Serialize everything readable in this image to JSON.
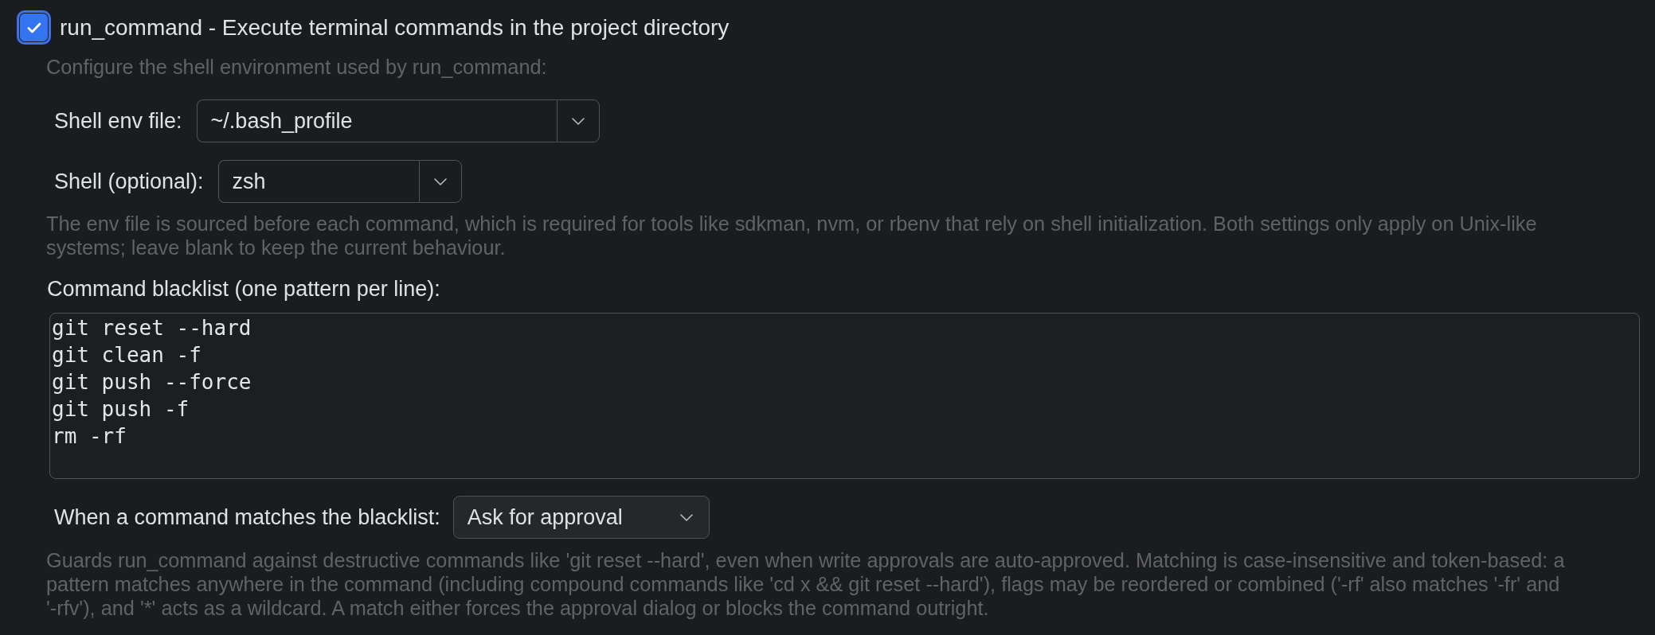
{
  "tool": {
    "label": "run_command - Execute terminal commands in the project directory",
    "checked": true,
    "focused": true
  },
  "shell_intro": "Configure the shell environment used by run_command:",
  "shell_fields": [
    {
      "label": "Shell env file:",
      "value": "~/.bash_profile"
    },
    {
      "label": "Shell (optional):",
      "value": "zsh"
    }
  ],
  "shell_help": "The env file is sourced before each command, which is required for tools like sdkman, nvm, or rbenv that rely on shell initialization. Both settings only apply on Unix-like systems; leave blank to keep the current behaviour.",
  "blacklist": {
    "label": "Command blacklist (one pattern per line):",
    "lines": [
      "git reset --hard",
      "git clean -f",
      "git push --force",
      "git push -f",
      "rm -rf"
    ]
  },
  "match_action": {
    "label": "When a command matches the blacklist:",
    "value": "Ask for approval"
  },
  "blacklist_help": "Guards run_command against destructive commands like 'git reset --hard', even when write approvals are auto-approved. Matching is case-insensitive and token-based: a pattern matches anywhere in the command (including compound commands like 'cd x && git reset --hard'), flags may be reordered or combined ('-rf' also matches '-fr' and '-rfv'), and '*' acts as a wildcard. A match either forces the approval dialog or blocks the command outright."
}
